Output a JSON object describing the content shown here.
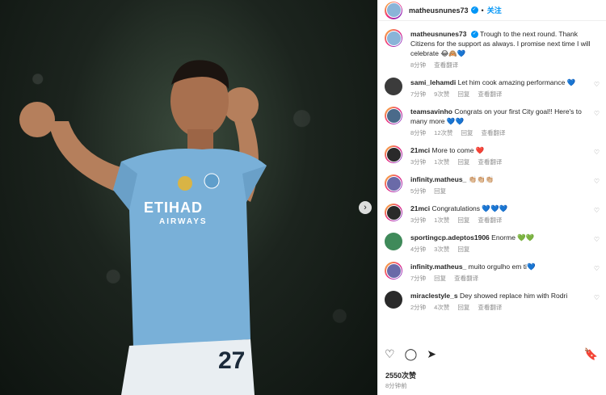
{
  "header": {
    "username": "matheusnunes73",
    "follow": "关注"
  },
  "caption": {
    "username": "matheusnunes73",
    "text": "Trough to the next round. Thank Citizens for the support as always. I promise next time I will celebrate 😂🙈💙",
    "time": "8分钟",
    "translate": "查看翻译"
  },
  "comments": [
    {
      "user": "sami_lehamdi",
      "text": "Let him cook amazing performance 💙",
      "time": "7分钟",
      "likes": "9次赞",
      "reply": "回复",
      "translate": "查看翻译"
    },
    {
      "user": "teamsavinho",
      "text": "Congrats on your first City goal!! Here's to many more 💙💙",
      "time": "8分钟",
      "likes": "12次赞",
      "reply": "回复",
      "translate": "查看翻译"
    },
    {
      "user": "21mci",
      "text": "More to come ❤️",
      "time": "3分钟",
      "likes": "1次赞",
      "reply": "回复",
      "translate": "查看翻译"
    },
    {
      "user": "infinity.matheus_",
      "text": "👏🏼👏🏼👏🏼",
      "time": "5分钟",
      "likes": "",
      "reply": "回复",
      "translate": ""
    },
    {
      "user": "21mci",
      "text": "Congratulations 💙💙💙",
      "time": "3分钟",
      "likes": "1次赞",
      "reply": "回复",
      "translate": "查看翻译"
    },
    {
      "user": "sportingcp.adeptos1906",
      "text": "Enorme 💚💚",
      "time": "4分钟",
      "likes": "3次赞",
      "reply": "回复",
      "translate": ""
    },
    {
      "user": "infinity.matheus_",
      "text": "muito orgulho em ti💙",
      "time": "7分钟",
      "likes": "",
      "reply": "回复",
      "translate": "查看翻译"
    },
    {
      "user": "miraclestyle_s",
      "text": "Dey showed replace him with Rodri",
      "time": "2分钟",
      "likes": "4次赞",
      "reply": "回复",
      "translate": "查看翻译"
    }
  ],
  "footer": {
    "likes": "2550次赞",
    "time": "8分钟前"
  },
  "photo": {
    "shirt_sponsor": "ETIHAD",
    "shirt_sponsor_sub": "AIRWAYS",
    "shirt_number": "27"
  }
}
